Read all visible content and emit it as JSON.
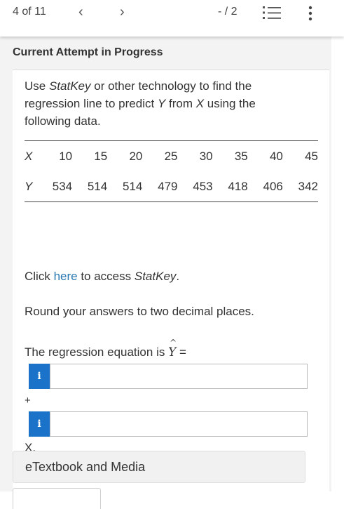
{
  "topbar": {
    "position": "4 of 11",
    "prev_icon": "chevron-left-icon",
    "next_icon": "chevron-right-icon",
    "score": "- / 2",
    "list_icon": "numbered-list-icon",
    "menu_icon": "kebab-menu-icon"
  },
  "panel": {
    "header": "Current Attempt in Progress"
  },
  "question": {
    "text_1": "Use ",
    "statkey": "StatKey",
    "text_2": " or other technology to find the regression line to predict ",
    "var_y": "Y",
    "text_3": " from ",
    "var_x": "X",
    "text_4": " using the following data."
  },
  "table": {
    "x_label": "X",
    "y_label": "Y",
    "x_values": [
      "10",
      "15",
      "20",
      "25",
      "30",
      "35",
      "40",
      "45"
    ],
    "y_values": [
      "534",
      "514",
      "514",
      "479",
      "453",
      "418",
      "406",
      "342"
    ]
  },
  "click_line": {
    "prefix": "Click ",
    "link": "here",
    "middle": " to access ",
    "statkey": "StatKey",
    "suffix": "."
  },
  "round_instruction": "Round your answers to two decimal places.",
  "equation": {
    "prefix": "The regression equation is ",
    "yhat": "Y",
    "hat": "^",
    "equals": " ="
  },
  "inputs": {
    "info_label": "i",
    "intercept_value": "",
    "slope_value": ""
  },
  "plus_sign": "+",
  "x_suffix": "X.",
  "etextbook_label": "eTextbook and Media",
  "colors": {
    "link": "#2a7ab0",
    "info_button": "#1a73c8",
    "panel_bg": "#f3f3f3"
  }
}
